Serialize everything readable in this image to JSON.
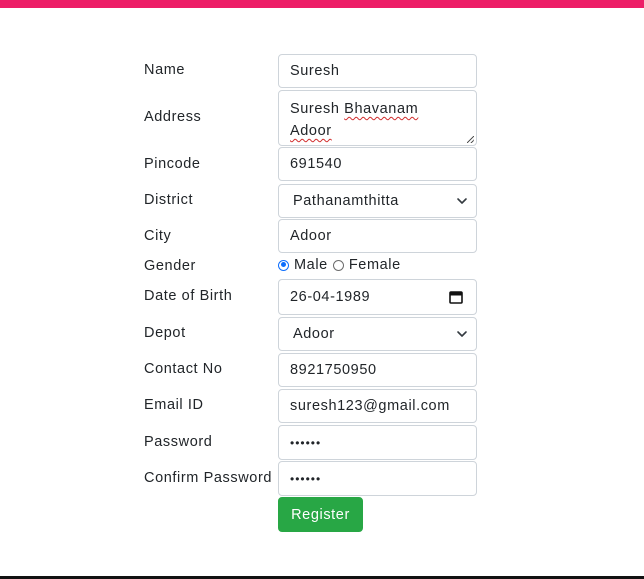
{
  "colors": {
    "top_bar": "#ed1e67",
    "button": "#28a745",
    "radio_accent": "#0d6efd"
  },
  "form": {
    "fields": {
      "name": {
        "label": "Name",
        "value": "Suresh"
      },
      "address": {
        "label": "Address",
        "value_line1_a": "Suresh ",
        "value_line1_b": "Bhavanam",
        "value_line2": "Adoor"
      },
      "pincode": {
        "label": "Pincode",
        "value": "691540"
      },
      "district": {
        "label": "District",
        "value": "Pathanamthitta"
      },
      "city": {
        "label": "City",
        "value": "Adoor"
      },
      "gender": {
        "label": "Gender",
        "options": [
          "Male",
          "Female"
        ],
        "selected": "Male"
      },
      "dob": {
        "label": "Date of Birth",
        "value": "26-04-1989"
      },
      "depot": {
        "label": "Depot",
        "value": "Adoor"
      },
      "contact": {
        "label": "Contact No",
        "value": "8921750950"
      },
      "email": {
        "label": "Email ID",
        "value": "suresh123@gmail.com"
      },
      "password": {
        "label": "Password",
        "value": "••••••"
      },
      "confirm_password": {
        "label": "Confirm Password",
        "value": "••••••"
      }
    },
    "submit_label": "Register"
  },
  "icons": {
    "select_arrow": "chevron-down-icon",
    "date_picker": "calendar-icon"
  }
}
